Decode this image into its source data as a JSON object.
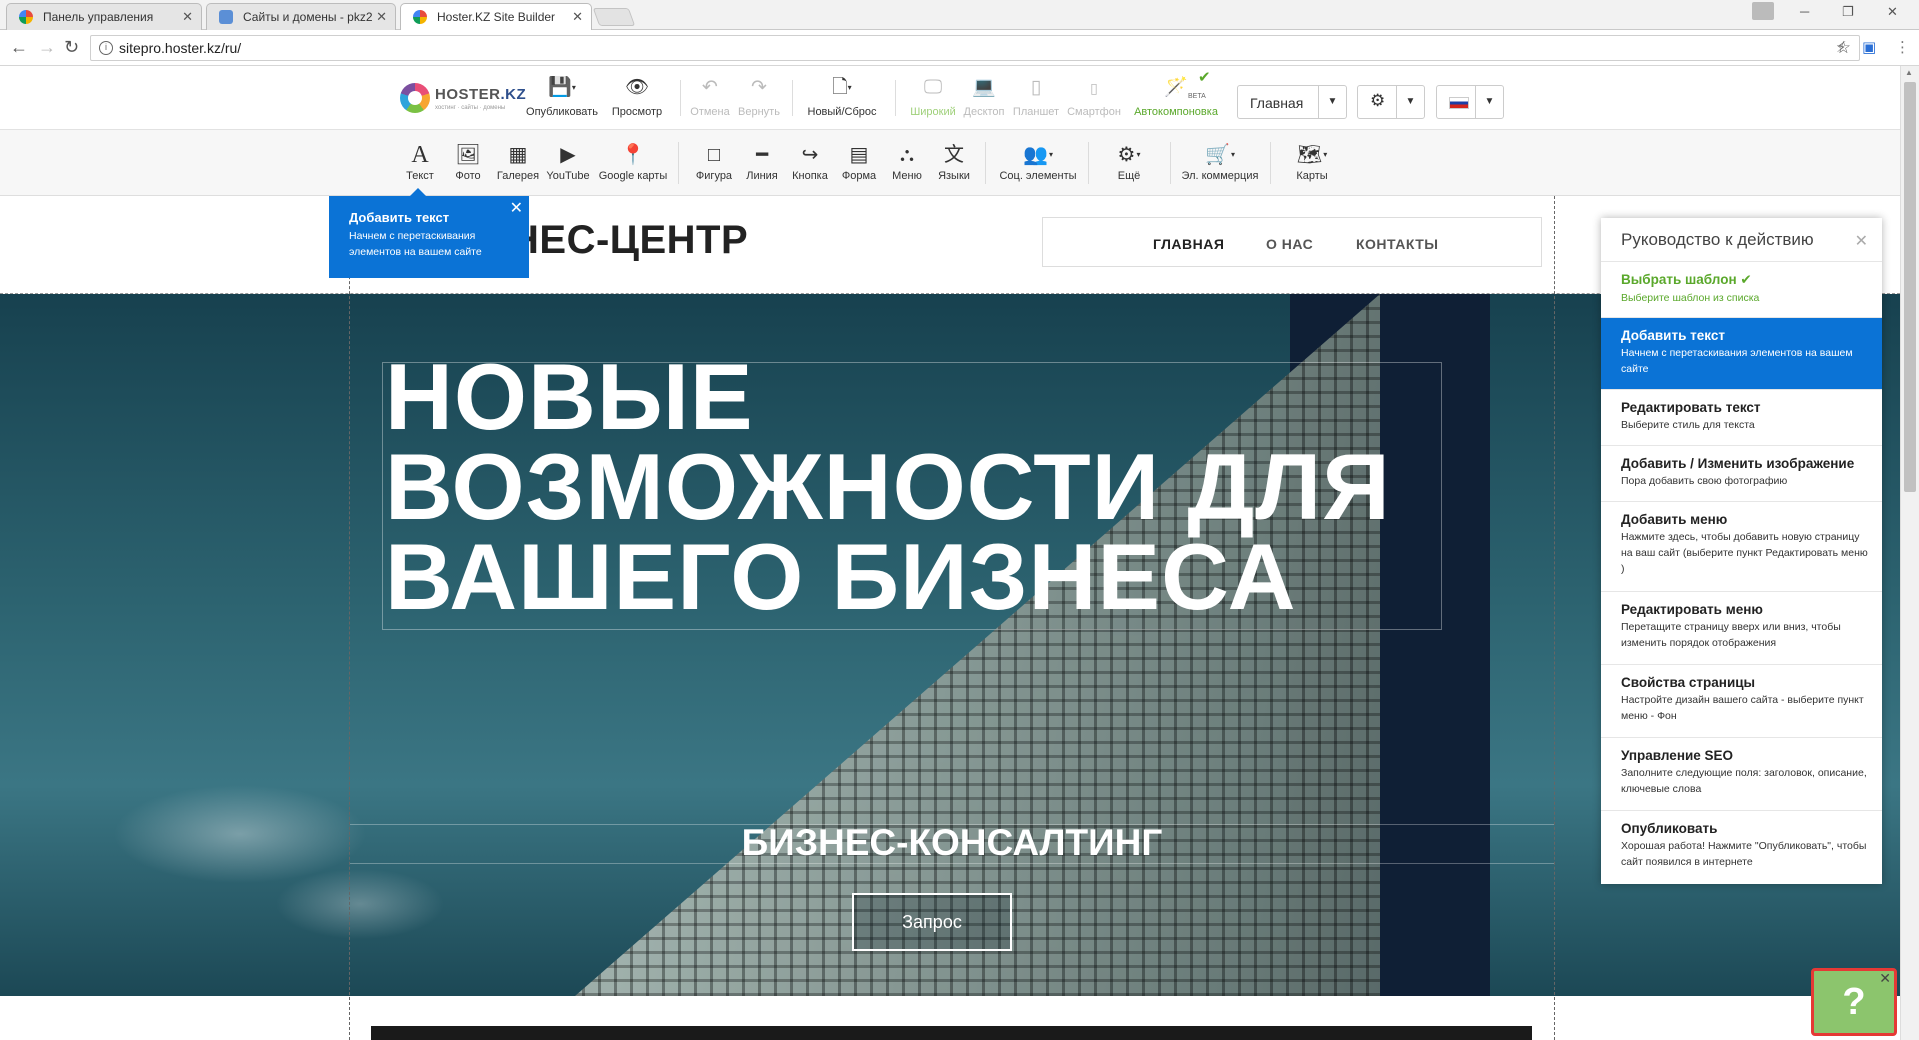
{
  "browser": {
    "tabs": [
      {
        "title": "Панель управления"
      },
      {
        "title": "Сайты и домены - pkz2"
      },
      {
        "title": "Hoster.KZ Site Builder"
      }
    ],
    "url": "sitepro.hoster.kz/ru/"
  },
  "toolbar1": {
    "logo_text": "HOSTER",
    "logo_suffix": ".KZ",
    "logo_sub": "хостинг · сайты · домены",
    "publish": "Опубликовать",
    "preview": "Просмотр",
    "undo": "Отмена",
    "redo": "Вернуть",
    "new_reset": "Новый/Сброс",
    "wide": "Широкий",
    "desktop": "Десктоп",
    "tablet": "Планшет",
    "phone": "Смартфон",
    "autolayout": "Автокомпоновка",
    "beta": "BETA",
    "page_select": "Главная"
  },
  "toolbar2": {
    "items": [
      {
        "label": "Текст"
      },
      {
        "label": "Фото"
      },
      {
        "label": "Галерея"
      },
      {
        "label": "YouTube"
      },
      {
        "label": "Google карты"
      },
      {
        "label": "Фигура"
      },
      {
        "label": "Линия"
      },
      {
        "label": "Кнопка"
      },
      {
        "label": "Форма"
      },
      {
        "label": "Меню"
      },
      {
        "label": "Языки"
      },
      {
        "label": "Соц. элементы"
      },
      {
        "label": "Ещё"
      },
      {
        "label": "Эл. коммерция"
      },
      {
        "label": "Карты"
      }
    ]
  },
  "site": {
    "title": "НЕС-ЦЕНТР",
    "menu": [
      "ГЛАВНАЯ",
      "О НАС",
      "КОНТАКТЫ"
    ],
    "hero_title_1": "НОВЫЕ",
    "hero_title_2": "ВОЗМОЖНОСТИ ДЛЯ",
    "hero_title_3": "ВАШЕГО БИЗНЕСА",
    "hero_subtitle": "БИЗНЕС-КОНСАЛТИНГ",
    "hero_button": "Запрос"
  },
  "tooltip": {
    "title": "Добавить текст",
    "desc": "Начнем с перетаскивания элементов на вашем сайте"
  },
  "guide": {
    "title": "Руководство к действию",
    "steps": [
      {
        "title": "Выбрать шаблон",
        "desc": "Выберите шаблон из списка"
      },
      {
        "title": "Добавить текст",
        "desc": "Начнем с перетаскивания элементов на вашем сайте"
      },
      {
        "title": "Редактировать текст",
        "desc": "Выберите стиль для текста"
      },
      {
        "title": "Добавить / Изменить изображение",
        "desc": "Пора добавить свою фотографию"
      },
      {
        "title": "Добавить меню",
        "desc": "Нажмите здесь, чтобы добавить новую страницу на ваш сайт (выберите пункт Редактировать меню )"
      },
      {
        "title": "Редактировать меню",
        "desc": "Перетащите страницу вверх или вниз, чтобы изменить порядок отображения"
      },
      {
        "title": "Свойства страницы",
        "desc": "Настройте дизайн вашего сайта - выберите пункт меню - Фон"
      },
      {
        "title": "Управление SEO",
        "desc": "Заполните следующие поля: заголовок, описание, ключевые слова"
      },
      {
        "title": "Опубликовать",
        "desc": "Хорошая работа! Нажмите \"Опубликовать\", чтобы сайт появился в интернете"
      }
    ]
  },
  "help": {
    "symbol": "?"
  },
  "colors": {
    "accent_blue": "#0b73d6",
    "done_green": "#5aa82b",
    "help_green": "#8cc56d"
  }
}
